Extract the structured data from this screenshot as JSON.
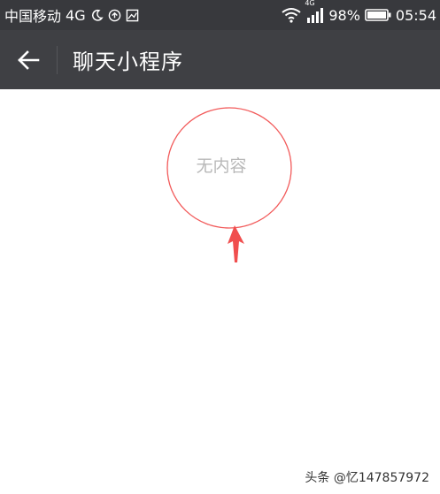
{
  "status_bar": {
    "carrier": "中国移动",
    "network": "4G",
    "signal_label": "4G",
    "battery": "98%",
    "time": "05:54",
    "icons": [
      "moon-icon",
      "sync-icon",
      "image-icon",
      "wifi-icon",
      "signal-icon",
      "battery-icon"
    ]
  },
  "header": {
    "back_icon": "arrow-left-icon",
    "title": "聊天小程序"
  },
  "main": {
    "empty_text": "无内容"
  },
  "annotation": {
    "color": "#f25a5a",
    "shapes": [
      "circle",
      "arrow"
    ]
  },
  "watermark": {
    "text": "头条 @忆147857972"
  },
  "colors": {
    "status_bar_bg": "#38393d",
    "title_bar_bg": "#3f4044",
    "empty_text": "#b8b8b8"
  }
}
